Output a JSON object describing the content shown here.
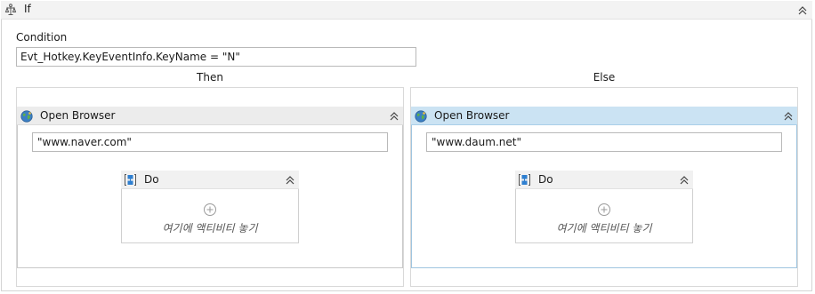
{
  "if_activity": {
    "title": "If"
  },
  "condition": {
    "label": "Condition",
    "value": "Evt_Hotkey.KeyEventInfo.KeyName = \"N\""
  },
  "then": {
    "label": "Then",
    "card_title": "Open Browser",
    "url": "\"www.naver.com\"",
    "do_title": "Do",
    "drop_hint": "여기에 액티비티 놓기"
  },
  "else": {
    "label": "Else",
    "card_title": "Open Browser",
    "url": "\"www.daum.net\"",
    "do_title": "Do",
    "drop_hint": "여기에 액티비티 놓기"
  },
  "icons": {
    "if": "if-activity-icon",
    "browser": "globe-icon",
    "do": "sequence-icon",
    "collapse": "chevron-double-up-icon",
    "add": "plus-circle-icon"
  }
}
